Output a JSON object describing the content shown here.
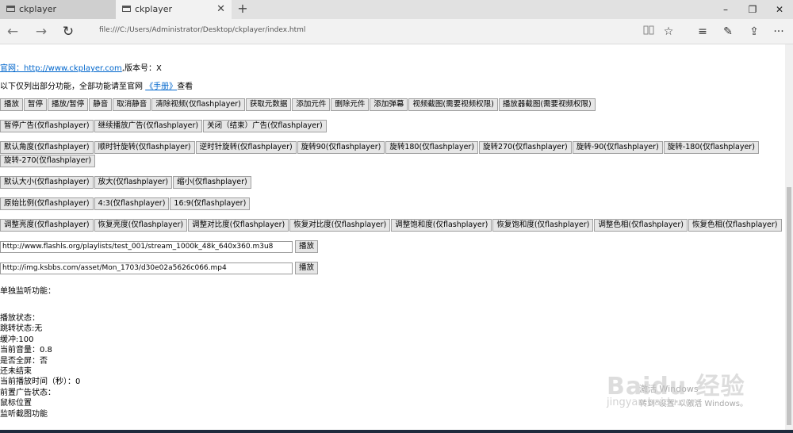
{
  "browser": {
    "tabs": [
      {
        "label": "ckplayer",
        "active": false
      },
      {
        "label": "ckplayer",
        "active": true
      }
    ],
    "new_tab": "+",
    "window_controls": {
      "minimize": "–",
      "maximize": "❐",
      "close": "✕"
    },
    "url": "file:///C:/Users/Administrator/Desktop/ckplayer/index.html",
    "nav": {
      "back": "←",
      "forward": "→",
      "refresh": "↻"
    },
    "tools": {
      "reading": "📖",
      "favorite": "☆",
      "hub": "≡",
      "note": "✎",
      "share": "⇪",
      "more": "···"
    }
  },
  "page": {
    "site_label": "官网：",
    "site_link": "http://www.ckplayer.com",
    "version_text": ",版本号：X",
    "intro_prefix": "以下仅列出部分功能，全部功能请至官网",
    "manual_link": "《手册》",
    "intro_suffix": "查看",
    "button_rows": [
      [
        "播放",
        "暂停",
        "播放/暂停",
        "静音",
        "取消静音",
        "清除视频(仅flashplayer)",
        "获取元数据",
        "添加元件",
        "删除元件",
        "添加弹幕",
        "视频截图(需要视频权限)",
        "播放器截图(需要视频权限)"
      ],
      [
        "暂停广告(仅flashplayer)",
        "继续播放广告(仅flashplayer)",
        "关闭（结束）广告(仅flashplayer)"
      ],
      [
        "默认角度(仅flashplayer)",
        "顺时针旋转(仅flashplayer)",
        "逆时针旋转(仅flashplayer)",
        "旋转90(仅flashplayer)",
        "旋转180(仅flashplayer)",
        "旋转270(仅flashplayer)",
        "旋转-90(仅flashplayer)",
        "旋转-180(仅flashplayer)",
        "旋转-270(仅flashplayer)"
      ],
      [
        "默认大小(仅flashplayer)",
        "放大(仅flashplayer)",
        "缩小(仅flashplayer)"
      ],
      [
        "原始比例(仅flashplayer)",
        "4:3(仅flashplayer)",
        "16:9(仅flashplayer)"
      ],
      [
        "调整亮度(仅flashplayer)",
        "恢复亮度(仅flashplayer)",
        "调整对比度(仅flashplayer)",
        "恢复对比度(仅flashplayer)",
        "调整饱和度(仅flashplayer)",
        "恢复饱和度(仅flashplayer)",
        "调整色相(仅flashplayer)",
        "恢复色相(仅flashplayer)"
      ]
    ],
    "url_inputs": [
      {
        "value": "http://www.flashls.org/playlists/test_001/stream_1000k_48k_640x360.m3u8",
        "button": "播放"
      },
      {
        "value": "http://img.ksbbs.com/asset/Mon_1703/d30e02a5626c066.mp4",
        "button": "播放"
      }
    ],
    "monitor_title": "单独监听功能：",
    "status_lines": [
      "播放状态：",
      "跳转状态:无",
      "缓冲:100",
      "当前音量：0.8",
      "是否全屏：否",
      "还未结束",
      "当前播放时间（秒）：0",
      "前置广告状态：",
      "鼠标位置",
      "监听截图功能"
    ]
  },
  "overlay": {
    "activate_title": "激活 Windows",
    "activate_sub": "转到\"设置\"以激活 Windows。",
    "watermark": "Baidu 经验",
    "watermark_sub": "jingyan.baidu.com"
  }
}
